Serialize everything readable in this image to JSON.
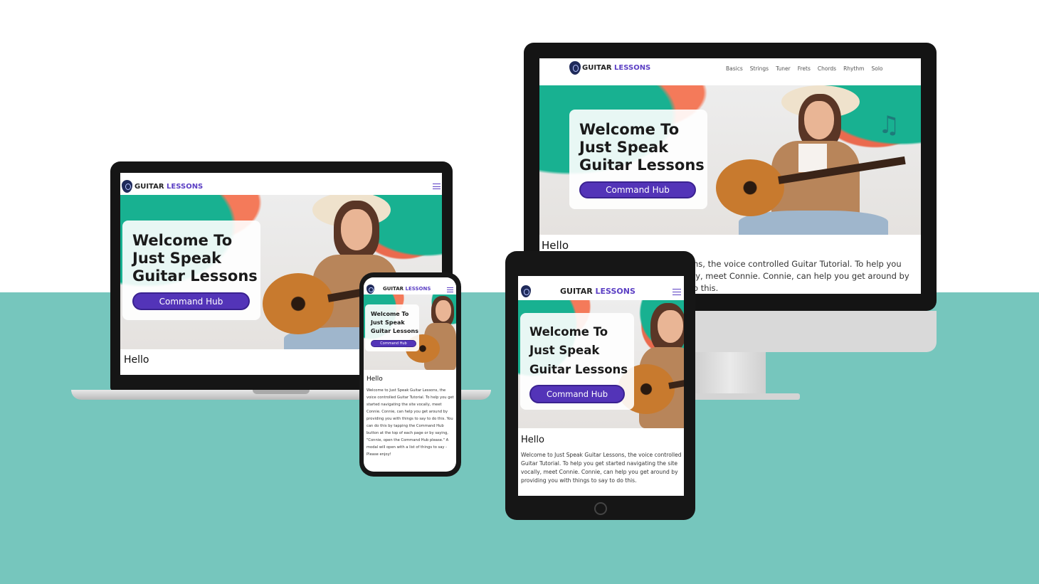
{
  "site": {
    "brand_part1": "GUITAR",
    "brand_part2": "LESSONS",
    "hero_title_line1": "Welcome To",
    "hero_title_line2": "Just Speak",
    "hero_title_line3": "Guitar Lessons",
    "command_button": "Command Hub",
    "hello_heading": "Hello",
    "nav_links": [
      "Basics",
      "Strings",
      "Tuner",
      "Frets",
      "Chords",
      "Rhythm",
      "Solo"
    ],
    "imac_para_line1": "ns, the voice controlled Guitar Tutorial. To help you",
    "imac_para_line2": "ly, meet Connie. Connie, can help you get around by",
    "imac_para_line3": "o this.",
    "tablet_para": "Welcome to Just Speak Guitar Lessons, the voice controlled Guitar Tutorial. To help you get started navigating the site vocally, meet Connie. Connie, can help you get around by providing you with things to say to do this.",
    "phone_para": "Welcome to Just Speak Guitar Lessons, the voice controlled Guitar Tutorial. To help you get started navigating the site vocally, meet Connie. Connie, can help you get around by providing you with things to say to do this. You can do this by tapping the Command Hub button at the top of each page or by saying, \"Connie, open the Command Hub please.\" A modal will open with a list of things to say - Please enjoy!"
  },
  "colors": {
    "accent": "#5334b8",
    "teal_background": "#76c6bd",
    "hero_teal": "#18b191",
    "hero_coral": "#f47a5a"
  },
  "icons": {
    "music_note": "♫",
    "apple_logo": ""
  }
}
